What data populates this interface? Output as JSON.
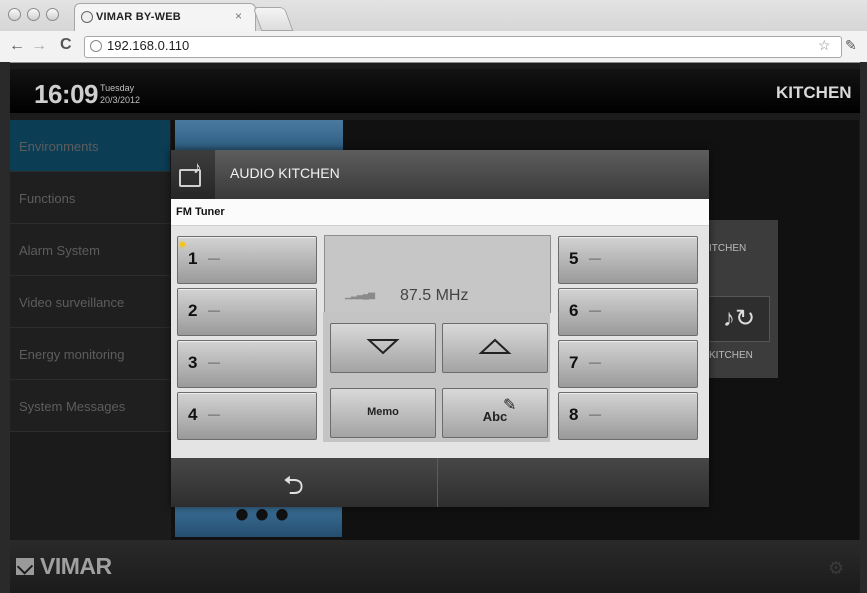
{
  "browser": {
    "tab_title": "VIMAR BY-WEB",
    "url": "192.168.0.110"
  },
  "header": {
    "time": "16:09",
    "day": "Tuesday",
    "date": "20/3/2012",
    "room": "KITCHEN"
  },
  "sidebar": {
    "items": [
      "Environments",
      "Functions",
      "Alarm System",
      "Video surveillance",
      "Energy monitoring",
      "System Messages"
    ]
  },
  "background": {
    "label_top": "ITCHEN",
    "label_bottom": "KITCHEN"
  },
  "modal": {
    "title": "AUDIO KITCHEN",
    "section": "FM Tuner",
    "frequency": "87.5 MHz",
    "presets_left": [
      {
        "num": "1",
        "name": "—"
      },
      {
        "num": "2",
        "name": "—"
      },
      {
        "num": "3",
        "name": "—"
      },
      {
        "num": "4",
        "name": "—"
      }
    ],
    "presets_right": [
      {
        "num": "5",
        "name": "—"
      },
      {
        "num": "6",
        "name": "—"
      },
      {
        "num": "7",
        "name": "—"
      },
      {
        "num": "8",
        "name": "—"
      }
    ],
    "memo_label": "Memo",
    "edit_label": "Abc"
  },
  "footer": {
    "logo": "VIMAR"
  }
}
